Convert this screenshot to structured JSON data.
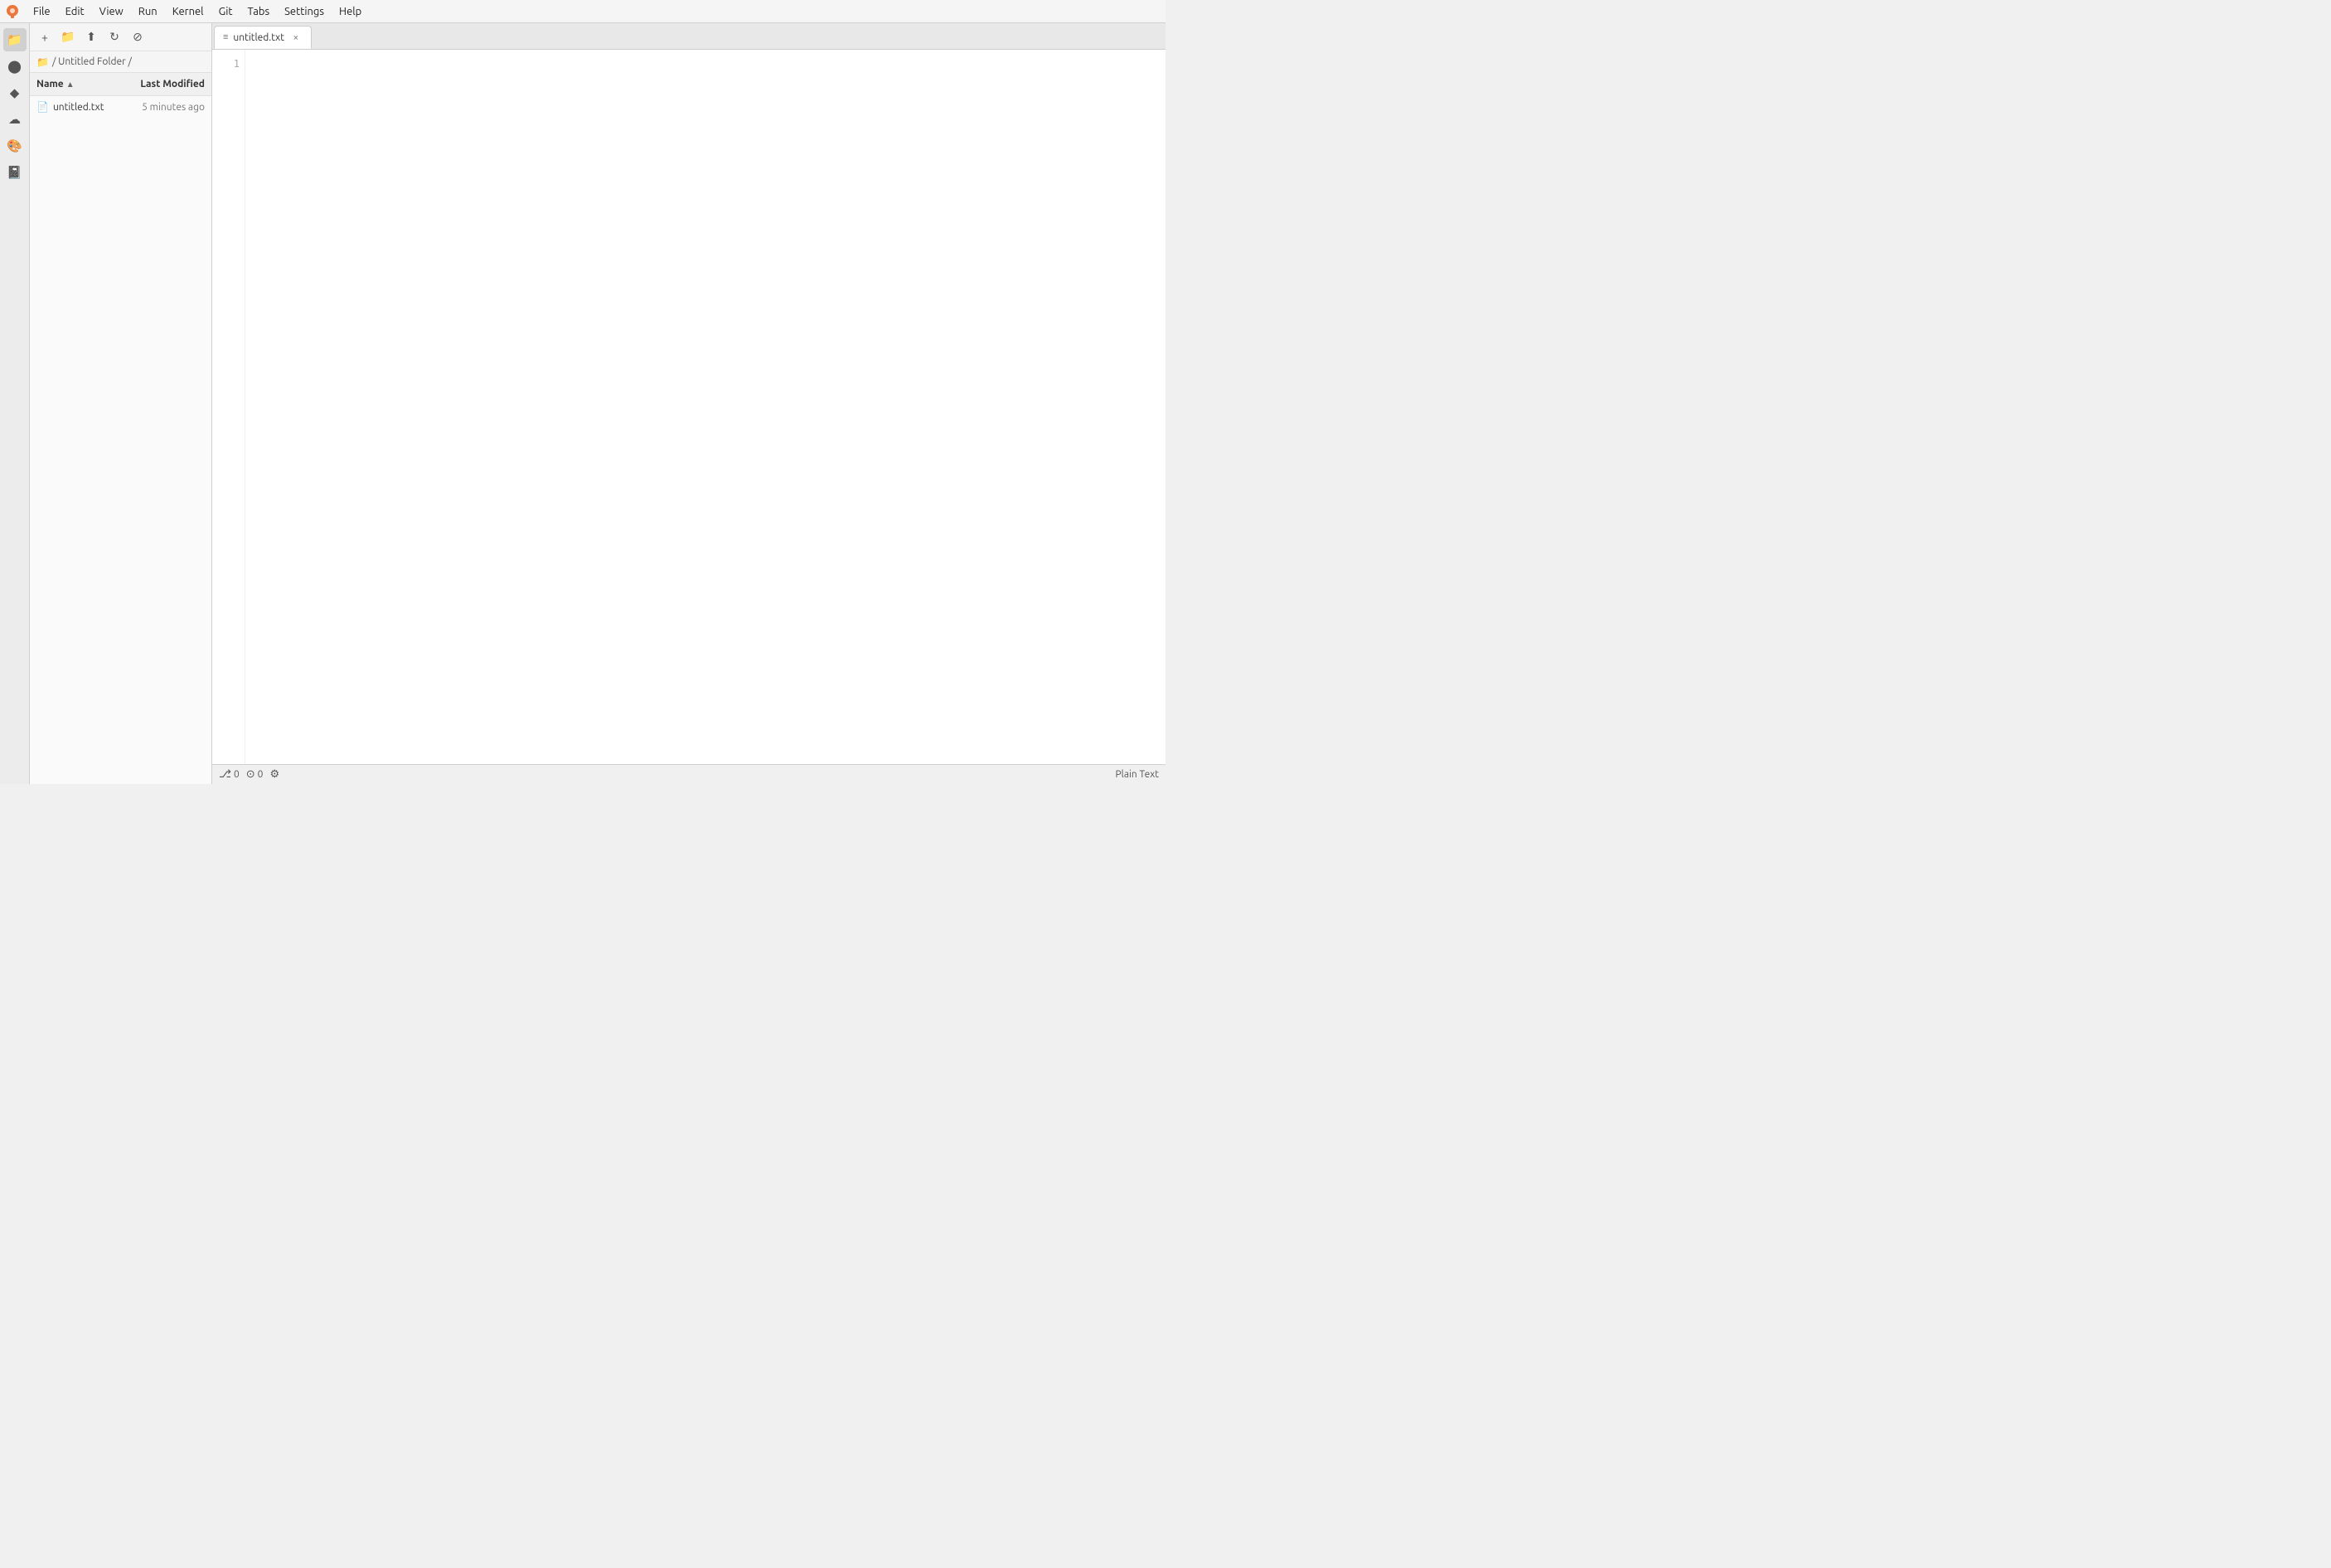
{
  "menubar": {
    "items": [
      {
        "label": "File",
        "id": "menu-file"
      },
      {
        "label": "Edit",
        "id": "menu-edit"
      },
      {
        "label": "View",
        "id": "menu-view"
      },
      {
        "label": "Run",
        "id": "menu-run"
      },
      {
        "label": "Kernel",
        "id": "menu-kernel"
      },
      {
        "label": "Git",
        "id": "menu-git"
      },
      {
        "label": "Tabs",
        "id": "menu-tabs"
      },
      {
        "label": "Settings",
        "id": "menu-settings"
      },
      {
        "label": "Help",
        "id": "menu-help"
      }
    ]
  },
  "sidebar": {
    "icons": [
      {
        "name": "folder-icon",
        "symbol": "📁",
        "active": true
      },
      {
        "name": "circle-icon",
        "symbol": "⬤",
        "active": false
      },
      {
        "name": "diamond-icon",
        "symbol": "◆",
        "active": false
      },
      {
        "name": "cloud-icon",
        "symbol": "☁",
        "active": false
      },
      {
        "name": "palette-icon",
        "symbol": "🎨",
        "active": false
      },
      {
        "name": "book-icon",
        "symbol": "📓",
        "active": false
      }
    ]
  },
  "file_toolbar": {
    "buttons": [
      {
        "name": "new-file-button",
        "symbol": "+"
      },
      {
        "name": "new-folder-button",
        "symbol": "📁"
      },
      {
        "name": "upload-button",
        "symbol": "⬆"
      },
      {
        "name": "refresh-button",
        "symbol": "↻"
      },
      {
        "name": "filter-button",
        "symbol": "⊘"
      }
    ]
  },
  "breadcrumb": {
    "parts": [
      "/ Untitled Folder /"
    ]
  },
  "file_list": {
    "headers": {
      "name": "Name",
      "modified": "Last Modified",
      "sort_arrow": "▲"
    },
    "files": [
      {
        "name": "untitled.txt",
        "icon": "📄",
        "modified": "5 minutes ago"
      }
    ]
  },
  "editor": {
    "tabs": [
      {
        "name": "untitled.txt",
        "icon": "≡",
        "active": true
      }
    ],
    "line_numbers": [
      "1"
    ],
    "content": ""
  },
  "statusbar": {
    "items": [
      {
        "name": "git-branch",
        "symbol": "⎇",
        "value": "0"
      },
      {
        "name": "issues-count",
        "symbol": "⊙",
        "value": "0"
      },
      {
        "name": "settings-icon",
        "symbol": "⚙"
      },
      {
        "name": "file-type",
        "value": "Plain Text"
      }
    ]
  }
}
